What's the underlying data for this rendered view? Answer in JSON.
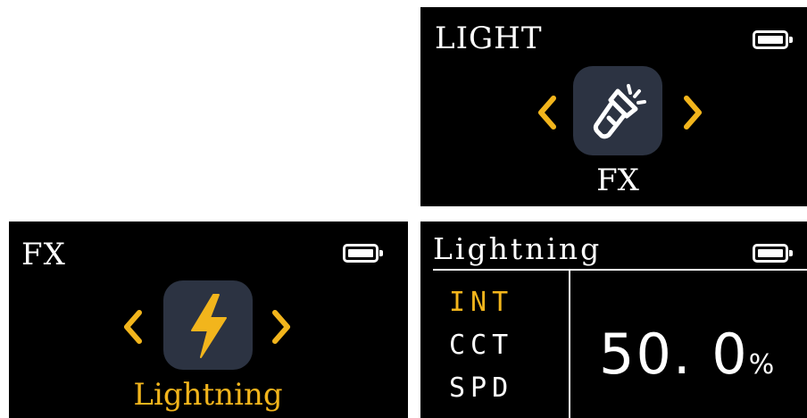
{
  "accent_color": "#f2b51c",
  "tile_color": "#2c3342",
  "light_screen": {
    "title": "LIGHT",
    "icon": "flashlight-icon",
    "selected_label": "FX",
    "battery_level": 1.0
  },
  "fx_screen": {
    "title": "FX",
    "icon": "lightning-bolt-icon",
    "selected_label": "Lightning",
    "battery_level": 1.0
  },
  "param_screen": {
    "title": "Lightning",
    "battery_level": 1.0,
    "params": [
      {
        "label": "INT",
        "active": true
      },
      {
        "label": "CCT",
        "active": false
      },
      {
        "label": "SPD",
        "active": false
      }
    ],
    "value": "50. 0",
    "unit": "%"
  }
}
